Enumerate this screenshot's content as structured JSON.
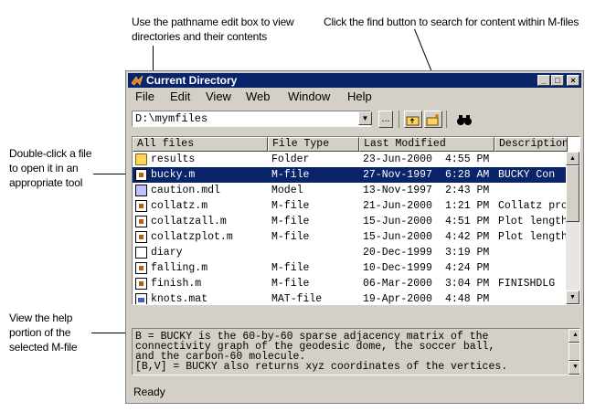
{
  "callouts": {
    "pathname_line1": "Use the pathname edit box to view",
    "pathname_line2": "directories and their contents",
    "find_line1": "Click the find button to search for content within M-files",
    "doubleclick_line1": "Double-click a file",
    "doubleclick_line2": "to open it in an",
    "doubleclick_line3": "appropriate tool",
    "help_line1": "View the help",
    "help_line2": "portion of the",
    "help_line3": "selected M-file"
  },
  "window": {
    "title": "Current Directory",
    "min_glyph": "_",
    "max_glyph": "□",
    "close_glyph": "×"
  },
  "menu": {
    "file": "File",
    "edit": "Edit",
    "view": "View",
    "web": "Web",
    "window": "Window",
    "help": "Help"
  },
  "toolbar": {
    "path_value": "D:\\mymfiles",
    "dropdown_glyph": "▼",
    "browse_label": "...",
    "up_glyph": "⬏",
    "newfolder_glyph": "✱",
    "find_glyph": "🔭"
  },
  "columns": [
    "All files",
    "File Type",
    "Last Modified",
    "Description"
  ],
  "files": [
    {
      "name": "results",
      "type": "Folder",
      "date": "23-Jun-2000",
      "time": "4:55 PM",
      "desc": "",
      "icon": "folder-icon"
    },
    {
      "name": "bucky.m",
      "type": "M-file",
      "date": "27-Nov-1997",
      "time": "6:28 AM",
      "desc": "BUCKY  Con",
      "icon": "m-file-icon"
    },
    {
      "name": "caution.mdl",
      "type": "Model",
      "date": "13-Nov-1997",
      "time": "2:43 PM",
      "desc": "",
      "icon": "model-icon"
    },
    {
      "name": "collatz.m",
      "type": "M-file",
      "date": "21-Jun-2000",
      "time": "1:21 PM",
      "desc": "Collatz pro",
      "icon": "m-file-icon"
    },
    {
      "name": "collatzall.m",
      "type": "M-file",
      "date": "15-Jun-2000",
      "time": "4:51 PM",
      "desc": "Plot length",
      "icon": "m-file-icon"
    },
    {
      "name": "collatzplot.m",
      "type": "M-file",
      "date": "15-Jun-2000",
      "time": "4:42 PM",
      "desc": "Plot length",
      "icon": "m-file-icon"
    },
    {
      "name": "diary",
      "type": "",
      "date": "20-Dec-1999",
      "time": "3:19 PM",
      "desc": "",
      "icon": "plain-file-icon"
    },
    {
      "name": "falling.m",
      "type": "M-file",
      "date": "10-Dec-1999",
      "time": "4:24 PM",
      "desc": "",
      "icon": "m-file-icon"
    },
    {
      "name": "finish.m",
      "type": "M-file",
      "date": "06-Mar-2000",
      "time": "3:04 PM",
      "desc": "FINISHDLG",
      "icon": "m-file-icon"
    },
    {
      "name": "knots.mat",
      "type": "MAT-file",
      "date": "19-Apr-2000",
      "time": "4:48 PM",
      "desc": "",
      "icon": "mat-file-icon"
    }
  ],
  "selected_index": 1,
  "help_text": [
    "B = BUCKY is the 60-by-60 sparse adjacency matrix of the",
    "connectivity graph of the geodesic dome, the soccer ball,",
    "and the carbon-60 molecule.",
    "[B,V] = BUCKY also returns xyz coordinates of the vertices."
  ],
  "status": "Ready",
  "colors": {
    "titlebar": "#0a246a",
    "selection": "#0a246a",
    "face": "#d4d0c8"
  }
}
